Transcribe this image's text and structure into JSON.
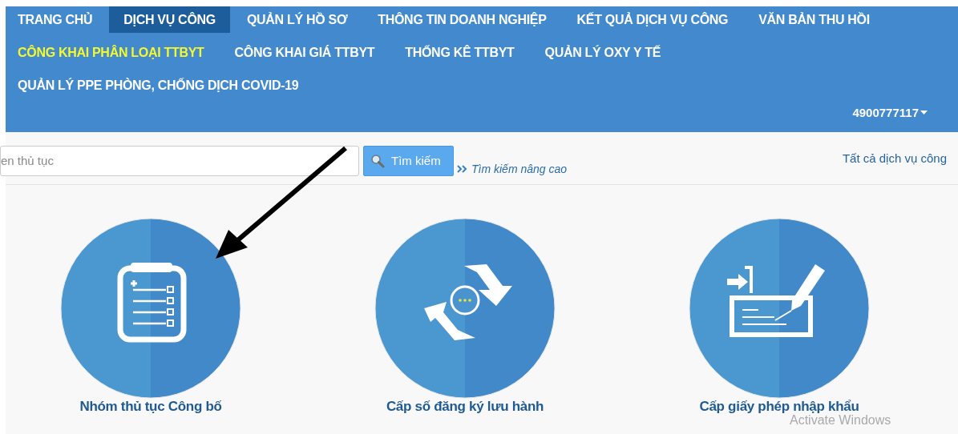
{
  "nav": {
    "items": [
      {
        "label": "TRANG CHỦ",
        "selected": false,
        "highlighted": false
      },
      {
        "label": "DỊCH VỤ CÔNG",
        "selected": true,
        "highlighted": false
      },
      {
        "label": "QUẢN LÝ HỒ SƠ",
        "selected": false,
        "highlighted": false
      },
      {
        "label": "THÔNG TIN DOANH NGHIỆP",
        "selected": false,
        "highlighted": false
      },
      {
        "label": "KẾT QUẢ DỊCH VỤ CÔNG",
        "selected": false,
        "highlighted": false
      },
      {
        "label": "VĂN BẢN THU HỒI",
        "selected": false,
        "highlighted": false
      },
      {
        "label": "CÔNG KHAI PHÂN LOẠI TTBYT",
        "selected": false,
        "highlighted": true
      },
      {
        "label": "CÔNG KHAI GIÁ TTBYT",
        "selected": false,
        "highlighted": false
      },
      {
        "label": "THỐNG KÊ TTBYT",
        "selected": false,
        "highlighted": false
      },
      {
        "label": "QUẢN LÝ OXY Y TẾ",
        "selected": false,
        "highlighted": false
      },
      {
        "label": "QUẢN LÝ PPE PHÒNG, CHỐNG DỊCH COVID-19",
        "selected": false,
        "highlighted": false
      }
    ],
    "user": "4900777117"
  },
  "search": {
    "placeholder": "en thủ tục",
    "button": "Tìm kiếm",
    "advanced": "Tìm kiếm nâng cao",
    "all_services": "Tất cả dịch vụ công"
  },
  "services": [
    {
      "kind": "clipboard",
      "label": "Nhóm thủ tục Công bố"
    },
    {
      "kind": "exchange",
      "label": "Cấp số đăng ký lưu hành"
    },
    {
      "kind": "import",
      "label": "Cấp giấy phép nhập khẩu"
    }
  ],
  "overlay": {
    "activation": "Activate Windows"
  }
}
